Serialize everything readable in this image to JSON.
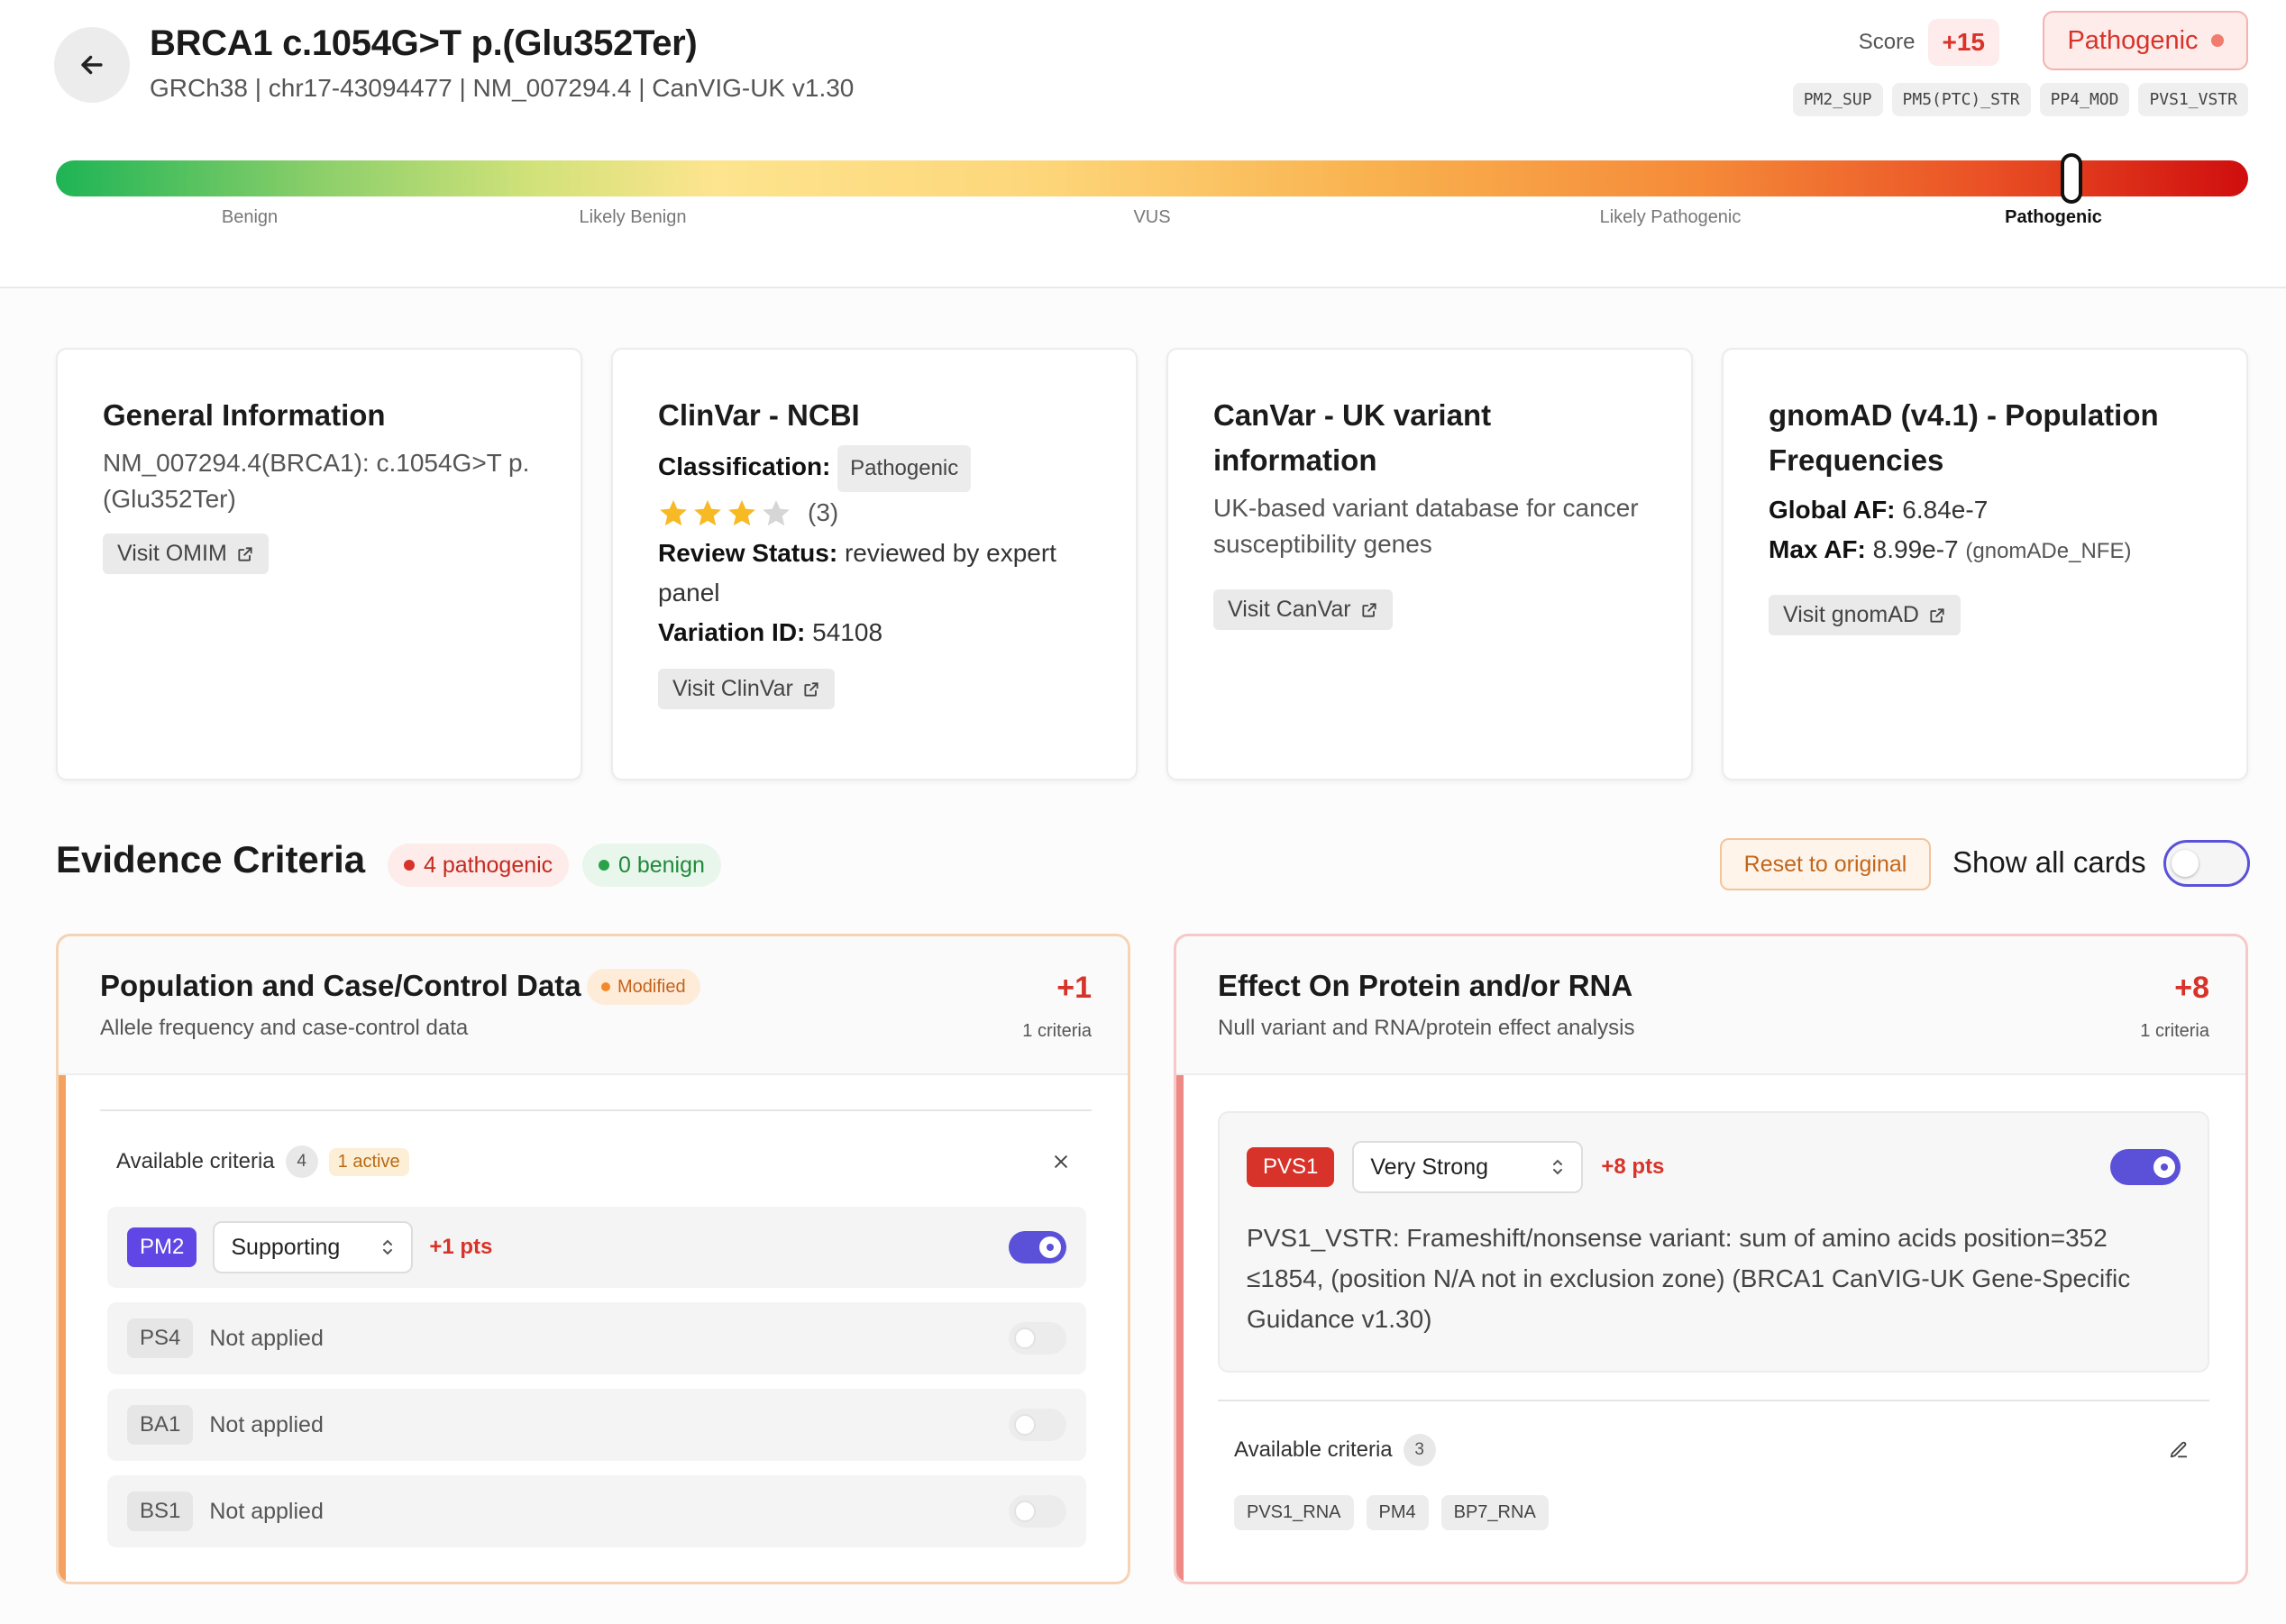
{
  "header": {
    "title": "BRCA1 c.1054G>T p.(Glu352Ter)",
    "subtitle": "GRCh38 | chr17-43094477 | NM_007294.4 | CanVIG-UK v1.30",
    "score_label": "Score",
    "score_value": "+15",
    "classification": "Pathogenic",
    "classification_color": "#f17b6d",
    "criteria_tags": [
      "PM2_SUP",
      "PM5(PTC)_STR",
      "PP4_MOD",
      "PVS1_VSTR"
    ],
    "scale": {
      "labels": [
        "Benign",
        "Likely Benign",
        "VUS",
        "Likely Pathogenic",
        "Pathogenic"
      ],
      "active": "Pathogenic"
    }
  },
  "cards": {
    "general": {
      "title": "General Information",
      "text": "NM_007294.4(BRCA1): c.1054G>T p.(Glu352Ter)",
      "button": "Visit OMIM"
    },
    "clinvar": {
      "title": "ClinVar - NCBI",
      "classification_label": "Classification:",
      "classification_value": "Pathogenic",
      "stars_filled": 3,
      "stars_total": 4,
      "stars_count": "(3)",
      "review_label": "Review Status:",
      "review_value": "reviewed by expert panel",
      "variation_label": "Variation ID:",
      "variation_value": "54108",
      "button": "Visit ClinVar"
    },
    "canvar": {
      "title": "CanVar - UK variant information",
      "text": "UK-based variant database for cancer susceptibility genes",
      "button": "Visit CanVar"
    },
    "gnomad": {
      "title": "gnomAD (v4.1) - Population Frequencies",
      "global_label": "Global AF:",
      "global_value": "6.84e-7",
      "max_label": "Max AF:",
      "max_value": "8.99e-7",
      "max_pop": "(gnomADe_NFE)",
      "button": "Visit gnomAD"
    }
  },
  "evidence": {
    "title": "Evidence Criteria",
    "pathogenic_pill": "4 pathogenic",
    "benign_pill": "0 benign",
    "reset_label": "Reset to original",
    "show_all_label": "Show all cards",
    "show_all_on": false
  },
  "panel_left": {
    "title": "Population and Case/Control Data",
    "badge": "Modified",
    "subtitle": "Allele frequency and case-control data",
    "score": "+1",
    "criteria_count": "1 criteria",
    "available_label": "Available criteria",
    "available_count": "4",
    "active_label": "1 active",
    "rows": [
      {
        "code": "PM2",
        "strength": "Supporting",
        "pts": "+1 pts",
        "on": true
      },
      {
        "code": "PS4",
        "status": "Not applied",
        "on": false
      },
      {
        "code": "BA1",
        "status": "Not applied",
        "on": false
      },
      {
        "code": "BS1",
        "status": "Not applied",
        "on": false
      }
    ]
  },
  "panel_right": {
    "title": "Effect On Protein and/or RNA",
    "subtitle": "Null variant and RNA/protein effect analysis",
    "score": "+8",
    "criteria_count": "1 criteria",
    "criterion": {
      "code": "PVS1",
      "strength": "Very Strong",
      "pts": "+8 pts",
      "on": true,
      "description": "PVS1_VSTR: Frameshift/nonsense variant: sum of amino acids position=352 ≤1854, (position N/A not in exclusion zone) (BRCA1 CanVIG-UK Gene-Specific Guidance v1.30)"
    },
    "available_label": "Available criteria",
    "available_count": "3",
    "available_tags": [
      "PVS1_RNA",
      "PM4",
      "BP7_RNA"
    ]
  }
}
